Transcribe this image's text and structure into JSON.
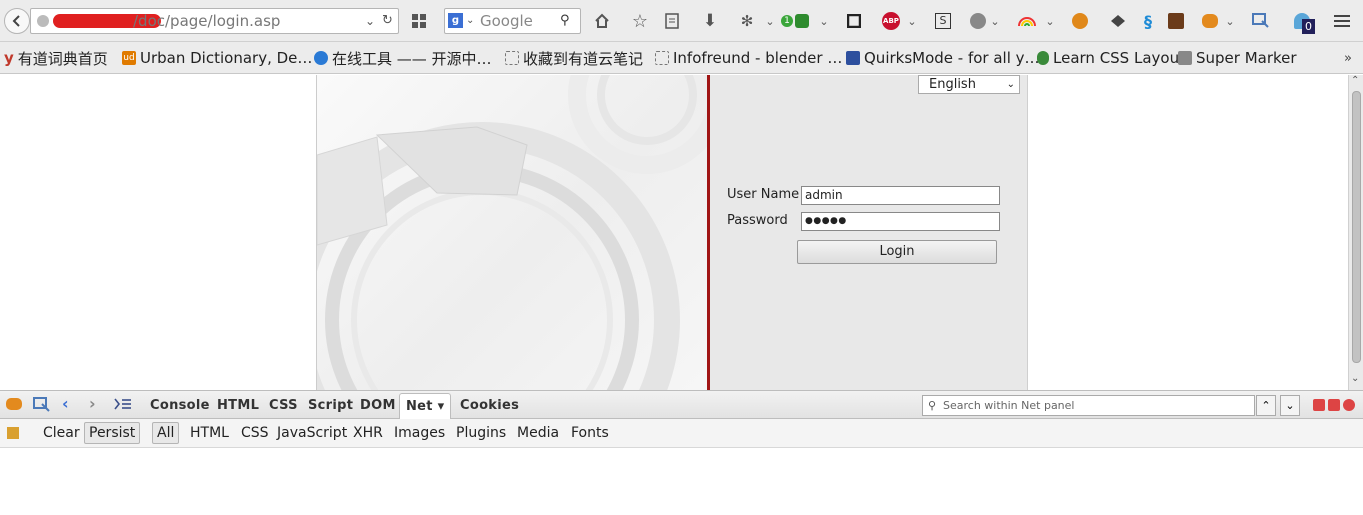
{
  "browser": {
    "url": "/doc/page/login.asp",
    "search_placeholder": "Google",
    "addon_badge": "1",
    "counter_badge": "0",
    "abp_label": "ABP"
  },
  "bookmarks": [
    {
      "label": "有道词典首页",
      "fav_color": "#c0392b"
    },
    {
      "label": "Urban Dictionary, De…",
      "fav_color": "#e07b00"
    },
    {
      "label": "在线工具 —— 开源中…",
      "fav_color": "#2a7ad5"
    },
    {
      "label": "收藏到有道云笔记",
      "fav_color": "#ffffff"
    },
    {
      "label": "Infofreund - blender …",
      "fav_color": "#ffffff"
    },
    {
      "label": "QuirksMode - for all y…",
      "fav_color": "#2d4f9e"
    },
    {
      "label": "Learn CSS Layout",
      "fav_color": "#3a8a3a"
    },
    {
      "label": "Super Marker",
      "fav_color": "#888888"
    }
  ],
  "login": {
    "language": "English",
    "username_label": "User Name",
    "username_value": "admin",
    "password_label": "Password",
    "password_value": "●●●●●",
    "login_button": "Login"
  },
  "firebug": {
    "tabs": [
      "Console",
      "HTML",
      "CSS",
      "Script",
      "DOM",
      "Net ▾",
      "Cookies"
    ],
    "active_tab": "Net ▾",
    "subtabs": [
      "Clear",
      "Persist",
      "All",
      "HTML",
      "CSS",
      "JavaScript",
      "XHR",
      "Images",
      "Plugins",
      "Media",
      "Fonts"
    ],
    "search_placeholder": "Search within Net panel"
  },
  "colors": {
    "accent_divider": "#a01515",
    "chrome_bg": "#ececec"
  }
}
